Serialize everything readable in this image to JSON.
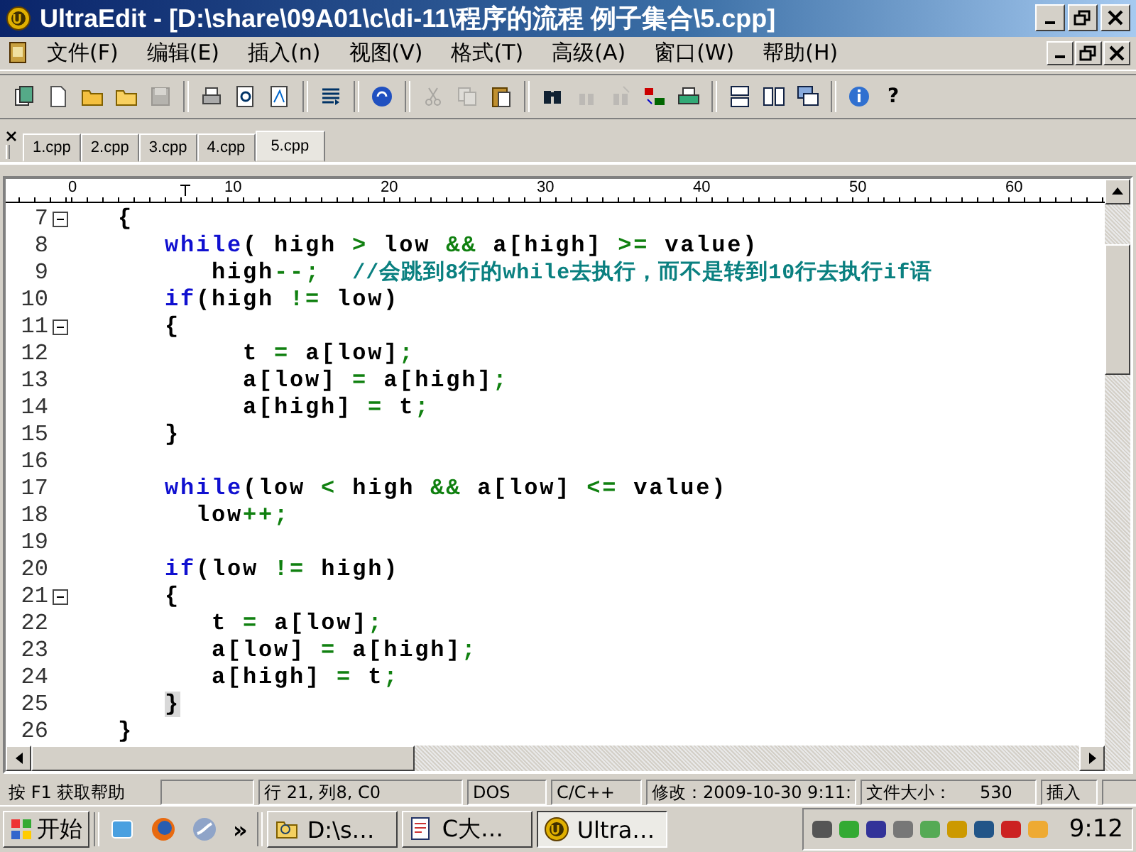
{
  "window": {
    "title": "UltraEdit - [D:\\share\\09A01\\c\\di-11\\程序的流程 例子集合\\5.cpp]"
  },
  "menu": [
    "文件(F)",
    "编辑(E)",
    "插入(n)",
    "视图(V)",
    "格式(T)",
    "高级(A)",
    "窗口(W)",
    "帮助(H)"
  ],
  "toolbar": {
    "groups": [
      [
        {
          "disabled": false
        },
        {
          "disabled": false
        },
        {
          "disabled": false
        },
        {
          "disabled": false
        },
        {
          "disabled": true
        }
      ],
      [
        {
          "disabled": false
        },
        {
          "disabled": false
        },
        {
          "disabled": false
        }
      ],
      [
        {
          "disabled": false
        }
      ],
      [
        {
          "disabled": false
        }
      ],
      [
        {
          "disabled": true
        },
        {
          "disabled": true
        },
        {
          "disabled": false
        }
      ],
      [
        {
          "disabled": false
        },
        {
          "disabled": true
        },
        {
          "disabled": true
        },
        {
          "disabled": false
        },
        {
          "disabled": false
        }
      ],
      [
        {
          "disabled": false
        },
        {
          "disabled": false
        },
        {
          "disabled": false
        }
      ],
      [
        {
          "disabled": false
        }
      ]
    ],
    "help_glyph": "?"
  },
  "tabs": [
    {
      "label": "1.cpp",
      "selected": false
    },
    {
      "label": "2.cpp",
      "selected": false
    },
    {
      "label": "3.cpp",
      "selected": false
    },
    {
      "label": "4.cpp",
      "selected": false
    },
    {
      "label": "5.cpp",
      "selected": true
    }
  ],
  "ruler": [
    "0",
    "10",
    "20",
    "30",
    "40",
    "50",
    "60"
  ],
  "lines": [
    {
      "number": "7",
      "fold": true,
      "tokens": [
        {
          "kind": "plain",
          "text": "   {"
        }
      ]
    },
    {
      "number": "8",
      "fold": false,
      "tokens": [
        {
          "kind": "keyword",
          "text": "      while"
        },
        {
          "kind": "plain",
          "text": "( high "
        },
        {
          "kind": "operator",
          "text": ">"
        },
        {
          "kind": "plain",
          "text": " low "
        },
        {
          "kind": "operator",
          "text": "&&"
        },
        {
          "kind": "plain",
          "text": " a[high] "
        },
        {
          "kind": "operator",
          "text": ">="
        },
        {
          "kind": "plain",
          "text": " value)"
        }
      ]
    },
    {
      "number": "9",
      "fold": false,
      "tokens": [
        {
          "kind": "plain",
          "text": "         high"
        },
        {
          "kind": "operator",
          "text": "--;"
        },
        {
          "kind": "comment",
          "text": "  //会跳到8行的while去执行，而不是转到10行去执行if语"
        }
      ]
    },
    {
      "number": "10",
      "fold": false,
      "tokens": [
        {
          "kind": "keyword",
          "text": "      if"
        },
        {
          "kind": "plain",
          "text": "(high "
        },
        {
          "kind": "operator",
          "text": "!="
        },
        {
          "kind": "plain",
          "text": " low)"
        }
      ]
    },
    {
      "number": "11",
      "fold": true,
      "tokens": [
        {
          "kind": "plain",
          "text": "      {"
        }
      ]
    },
    {
      "number": "12",
      "fold": false,
      "tokens": [
        {
          "kind": "plain",
          "text": "           t "
        },
        {
          "kind": "operator",
          "text": "="
        },
        {
          "kind": "plain",
          "text": " a[low]"
        },
        {
          "kind": "operator",
          "text": ";"
        }
      ]
    },
    {
      "number": "13",
      "fold": false,
      "tokens": [
        {
          "kind": "plain",
          "text": "           a[low] "
        },
        {
          "kind": "operator",
          "text": "="
        },
        {
          "kind": "plain",
          "text": " a[high]"
        },
        {
          "kind": "operator",
          "text": ";"
        }
      ]
    },
    {
      "number": "14",
      "fold": false,
      "tokens": [
        {
          "kind": "plain",
          "text": "           a[high] "
        },
        {
          "kind": "operator",
          "text": "="
        },
        {
          "kind": "plain",
          "text": " t"
        },
        {
          "kind": "operator",
          "text": ";"
        }
      ]
    },
    {
      "number": "15",
      "fold": false,
      "tokens": [
        {
          "kind": "plain",
          "text": "      }"
        }
      ]
    },
    {
      "number": "16",
      "fold": false
    },
    {
      "number": "17",
      "fold": false,
      "tokens": [
        {
          "kind": "keyword",
          "text": "      while"
        },
        {
          "kind": "plain",
          "text": "(low "
        },
        {
          "kind": "operator",
          "text": "<"
        },
        {
          "kind": "plain",
          "text": " high "
        },
        {
          "kind": "operator",
          "text": "&&"
        },
        {
          "kind": "plain",
          "text": " a[low] "
        },
        {
          "kind": "operator",
          "text": "<="
        },
        {
          "kind": "plain",
          "text": " value)"
        }
      ]
    },
    {
      "number": "18",
      "fold": false,
      "tokens": [
        {
          "kind": "plain",
          "text": "        low"
        },
        {
          "kind": "operator",
          "text": "++;"
        }
      ]
    },
    {
      "number": "19",
      "fold": false
    },
    {
      "number": "20",
      "fold": false,
      "tokens": [
        {
          "kind": "keyword",
          "text": "      if"
        },
        {
          "kind": "plain",
          "text": "(low "
        },
        {
          "kind": "operator",
          "text": "!="
        },
        {
          "kind": "plain",
          "text": " high)"
        }
      ]
    },
    {
      "number": "21",
      "fold": true,
      "tokens": [
        {
          "kind": "plain",
          "text": "      {"
        }
      ]
    },
    {
      "number": "22",
      "fold": false,
      "tokens": [
        {
          "kind": "plain",
          "text": "         t "
        },
        {
          "kind": "operator",
          "text": "="
        },
        {
          "kind": "plain",
          "text": " a[low]"
        },
        {
          "kind": "operator",
          "text": ";"
        }
      ]
    },
    {
      "number": "23",
      "fold": false,
      "tokens": [
        {
          "kind": "plain",
          "text": "         a[low] "
        },
        {
          "kind": "operator",
          "text": "="
        },
        {
          "kind": "plain",
          "text": " a[high]"
        },
        {
          "kind": "operator",
          "text": ";"
        }
      ]
    },
    {
      "number": "24",
      "fold": false,
      "tokens": [
        {
          "kind": "plain",
          "text": "         a[high] "
        },
        {
          "kind": "operator",
          "text": "="
        },
        {
          "kind": "plain",
          "text": " t"
        },
        {
          "kind": "operator",
          "text": ";"
        }
      ]
    },
    {
      "number": "25",
      "fold": false,
      "tokens": [
        {
          "kind": "match",
          "text": "      }"
        }
      ]
    },
    {
      "number": "26",
      "fold": false,
      "tokens": [
        {
          "kind": "plain",
          "text": "   }"
        }
      ]
    }
  ],
  "status_bar": {
    "help": "按 F1 获取帮助",
    "position": "行 21, 列8, C0",
    "line_ending": "DOS",
    "language": "C/C++",
    "modified": "修改：2009-10-30 9:11:",
    "file_size_label": "文件大小：",
    "file_size": "530",
    "mode": "插入"
  },
  "taskbar": {
    "start": "开始",
    "more": "»",
    "tasks": [
      {
        "label": "D:\\s…",
        "selected": false
      },
      {
        "label": "C大…",
        "selected": false
      },
      {
        "label": "Ultra…",
        "selected": true
      }
    ],
    "clock": "9:12"
  }
}
